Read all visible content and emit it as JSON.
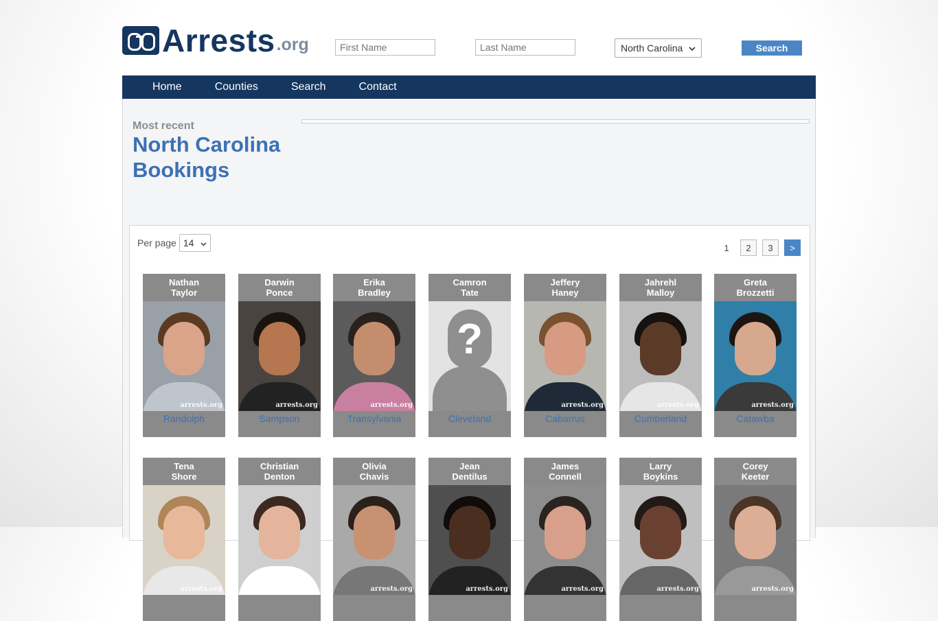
{
  "header": {
    "logo_word": "Arrests",
    "logo_tld": ".org",
    "first_name_placeholder": "First Name",
    "last_name_placeholder": "Last Name",
    "state_selected": "North Carolina",
    "search_label": "Search"
  },
  "nav": {
    "items": [
      "Home",
      "Counties",
      "Search",
      "Contact"
    ]
  },
  "main": {
    "kicker": "Most recent",
    "title": "North Carolina Bookings"
  },
  "listing": {
    "per_page_label": "Per page",
    "per_page_value": "14",
    "pages": [
      "1",
      "2",
      "3",
      ">"
    ],
    "current_page": "1",
    "watermark": "arrests.org",
    "bookings": [
      {
        "first": "Nathan",
        "last": "Taylor",
        "county": "Randolph"
      },
      {
        "first": "Darwin",
        "last": "Ponce",
        "county": "Sampson"
      },
      {
        "first": "Erika",
        "last": "Bradley",
        "county": "Transylvania"
      },
      {
        "first": "Camron",
        "last": "Tate",
        "county": "Cleveland",
        "placeholder": true
      },
      {
        "first": "Jeffery",
        "last": "Haney",
        "county": "Cabarrus"
      },
      {
        "first": "Jahrehl",
        "last": "Malloy",
        "county": "Cumberland"
      },
      {
        "first": "Greta",
        "last": "Brozzetti",
        "county": "Catawba"
      },
      {
        "first": "Tena",
        "last": "Shore",
        "county": ""
      },
      {
        "first": "Christian",
        "last": "Denton",
        "county": ""
      },
      {
        "first": "Olivia",
        "last": "Chavis",
        "county": ""
      },
      {
        "first": "Jean",
        "last": "Dentilus",
        "county": ""
      },
      {
        "first": "James",
        "last": "Connell",
        "county": ""
      },
      {
        "first": "Larry",
        "last": "Boykins",
        "county": ""
      },
      {
        "first": "Corey",
        "last": "Keeter",
        "county": ""
      }
    ]
  },
  "colors": {
    "brand_navy": "#15365f",
    "accent_blue": "#4a86c6",
    "link_blue": "#3c71b4",
    "card_gray": "#8a8a8a"
  }
}
